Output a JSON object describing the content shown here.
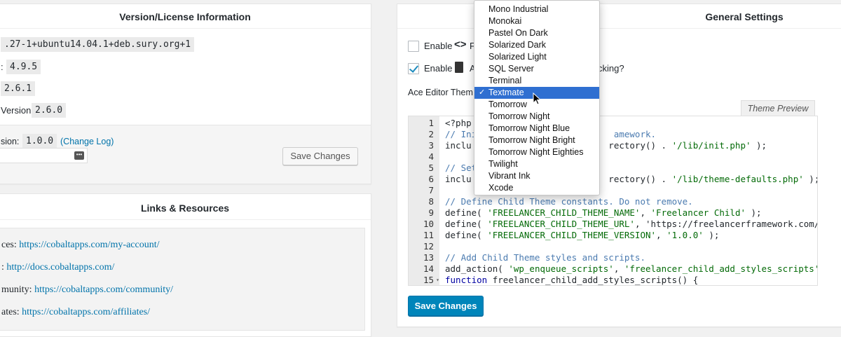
{
  "version_panel": {
    "title": "Version/License Information",
    "php_version": ".27-1+ubuntu14.04.1+deb.sury.org+1",
    "wp_label": ":",
    "wp_version": "4.9.5",
    "row3_value": "2.6.1",
    "row4_label": "Version:",
    "row4_value": "2.6.0",
    "row5_label": "sion:",
    "row5_value": "1.0.0",
    "changelog_link": "(Change Log)",
    "save_label": "Save Changes"
  },
  "links_panel": {
    "title": "Links & Resources",
    "items": [
      {
        "label": "ces:",
        "url": "https://cobaltapps.com/my-account/"
      },
      {
        "label": ":",
        "url": "http://docs.cobaltapps.com/"
      },
      {
        "label": "munity:",
        "url": "https://cobaltapps.com/community/"
      },
      {
        "label": "ates:",
        "url": "https://cobaltapps.com/affiliates/"
      }
    ]
  },
  "general_settings": {
    "title": "General Settings",
    "enable1_label": "Enable",
    "enable1_tail": "F",
    "enable2_label": "Enable",
    "enable2_tail": "A",
    "enable2_suffix": "cking?",
    "ace_label": "Ace Editor Them",
    "theme_preview_tab": "Theme Preview",
    "save_label": "Save Changes"
  },
  "theme_dropdown": {
    "items": [
      "Mono Industrial",
      "Monokai",
      "Pastel On Dark",
      "Solarized Dark",
      "Solarized Light",
      "SQL Server",
      "Terminal",
      "Textmate",
      "Tomorrow",
      "Tomorrow Night",
      "Tomorrow Night Blue",
      "Tomorrow Night Bright",
      "Tomorrow Night Eighties",
      "Twilight",
      "Vibrant Ink",
      "Xcode"
    ],
    "selected": "Textmate",
    "check": "✓"
  },
  "code": {
    "lines": [
      {
        "n": "1",
        "text": "<?php"
      },
      {
        "n": "2",
        "text": "// Ini                          amework."
      },
      {
        "n": "3",
        "text": "inclu                          rectory() . '/lib/init.php' );"
      },
      {
        "n": "4",
        "text": ""
      },
      {
        "n": "5",
        "text": "// Set"
      },
      {
        "n": "6",
        "text": "inclu                          rectory() . '/lib/theme-defaults.php' );"
      },
      {
        "n": "7",
        "text": ""
      },
      {
        "n": "8",
        "text": "// Define Child Theme constants. Do not remove."
      },
      {
        "n": "9",
        "text": "define( 'FREELANCER_CHILD_THEME_NAME', 'Freelancer Child' );"
      },
      {
        "n": "10",
        "text": "define( 'FREELANCER_CHILD_THEME_URL', 'https://freelancerframework.com/dow"
      },
      {
        "n": "11",
        "text": "define( 'FREELANCER_CHILD_THEME_VERSION', '1.0.0' );"
      },
      {
        "n": "12",
        "text": ""
      },
      {
        "n": "13",
        "text": "// Add Child Theme styles and scripts."
      },
      {
        "n": "14",
        "text": "add_action( 'wp_enqueue_scripts', 'freelancer_child_add_styles_scripts' );"
      },
      {
        "n": "15",
        "text": "function freelancer_child_add_styles_scripts() {"
      }
    ],
    "fold_marker": "▾"
  }
}
